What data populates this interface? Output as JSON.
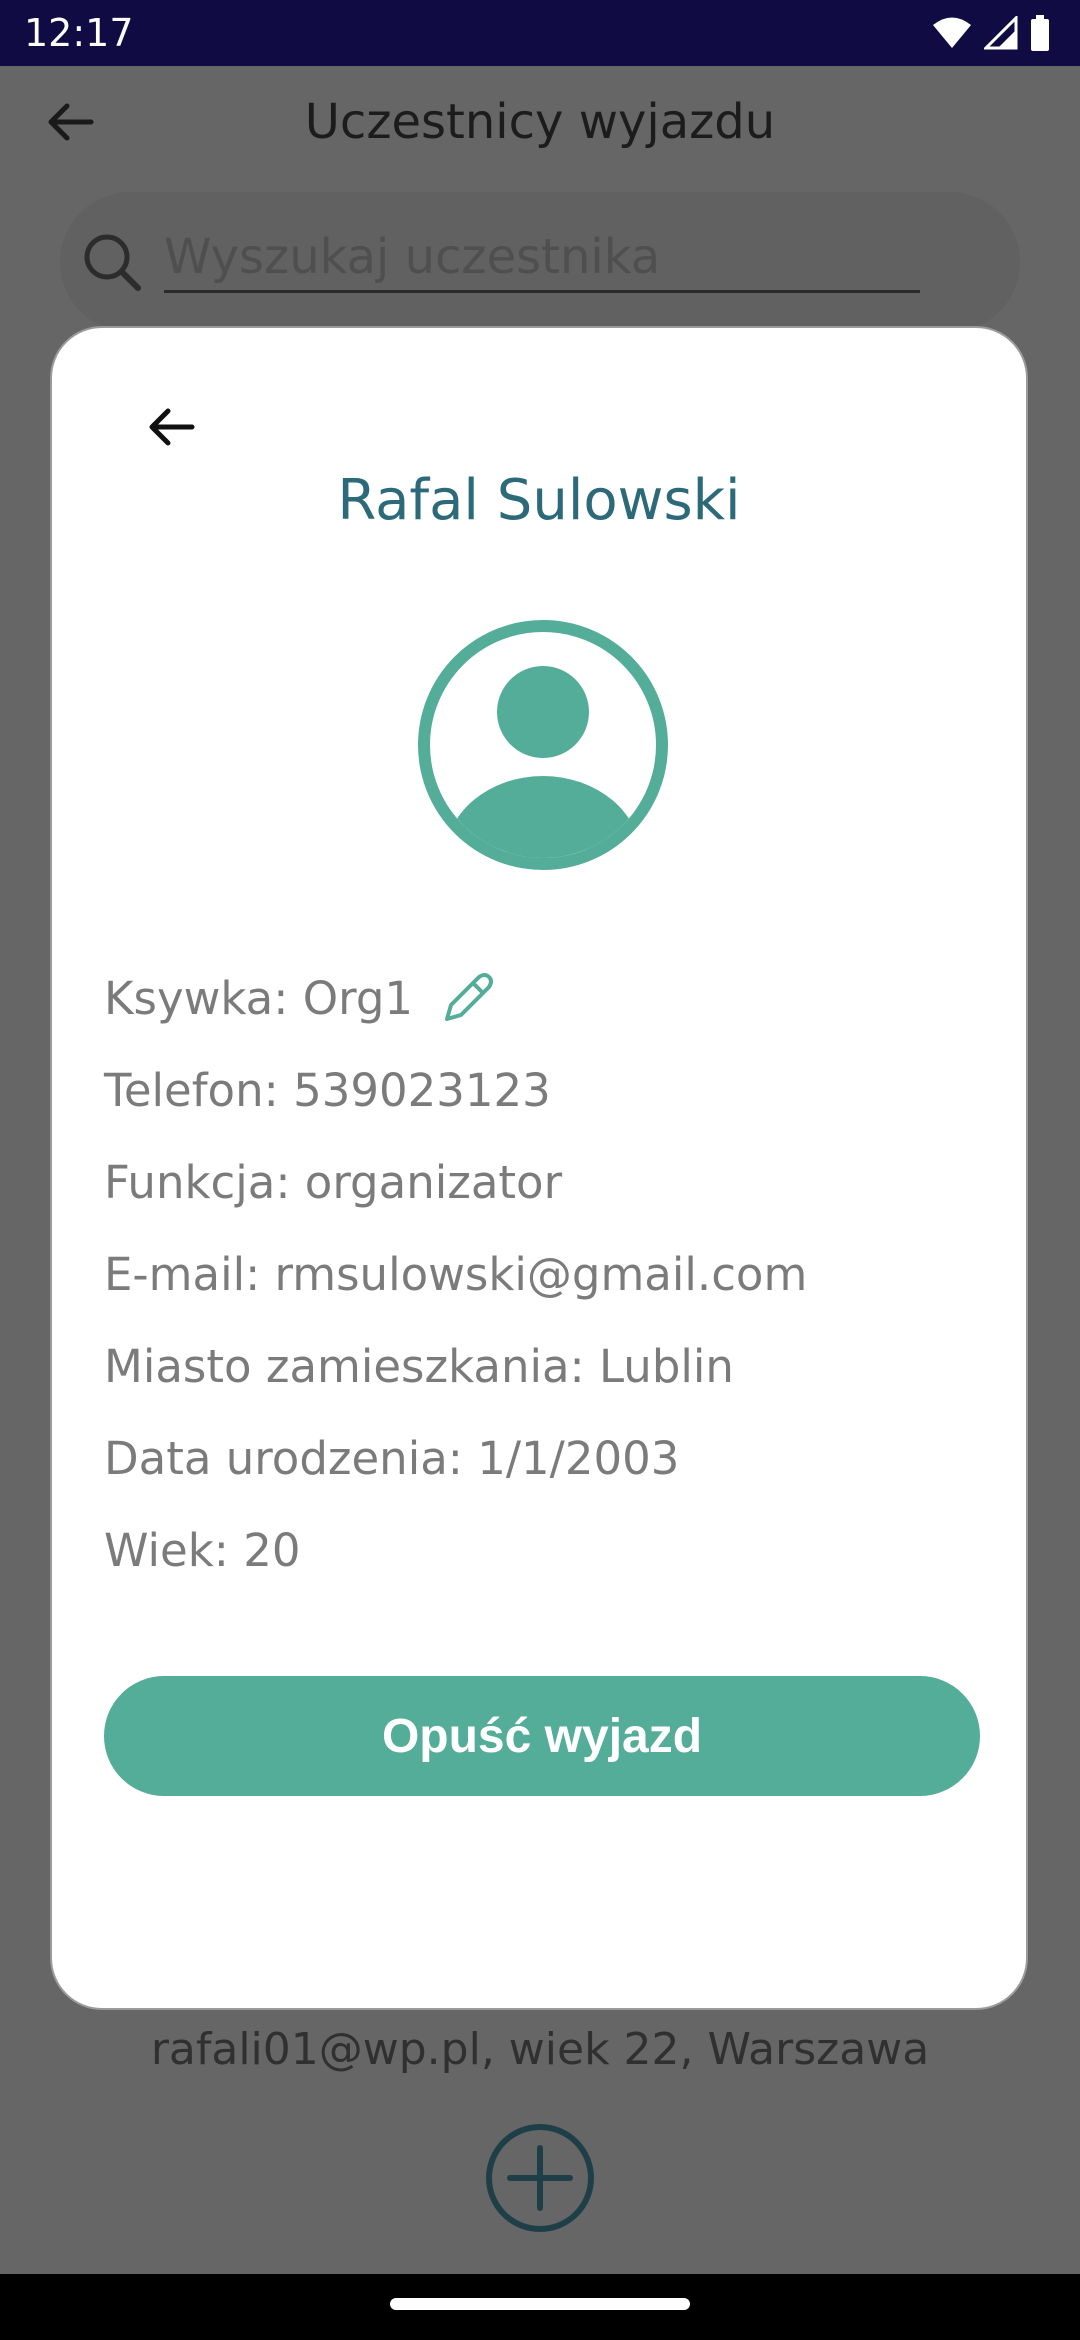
{
  "status_bar": {
    "time": "12:17",
    "icons": [
      "wifi-icon",
      "cellular-signal-icon",
      "battery-icon"
    ]
  },
  "screen": {
    "title": "Uczestnicy wyjazdu",
    "search_placeholder": "Wyszukaj uczestnika",
    "background_item_text": "rafali01@wp.pl, wiek 22, Warszawa"
  },
  "dialog": {
    "name": "Rafal Sulowski",
    "fields": {
      "nickname": "Ksywka: Org1",
      "phone": "Telefon: 539023123",
      "role": "Funkcja: organizator",
      "email": "E-mail: rmsulowski@gmail.com",
      "city": "Miasto zamieszkania: Lublin",
      "birthdate": "Data urodzenia: 1/1/2003",
      "age": "Wiek: 20"
    },
    "leave_button": "Opuść wyjazd"
  },
  "colors": {
    "accent": "#54ad99",
    "name_text": "#2c6a7a",
    "status_bar": "#110b44",
    "scrim": "#666666"
  }
}
